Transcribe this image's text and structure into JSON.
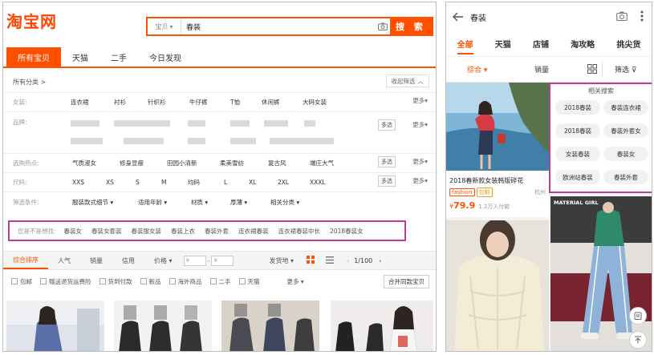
{
  "desktop": {
    "logo": "淘宝网",
    "search": {
      "category": "宝贝",
      "query": "春装",
      "button": "搜 索"
    },
    "tabs": [
      "所有宝贝",
      "天猫",
      "二手",
      "今日发现"
    ],
    "breadcrumb": "所有分类 >",
    "collapse_label": "收起筛选",
    "filters": {
      "style": {
        "label": "女装:",
        "values": [
          "连衣裙",
          "衬衫",
          "针织衫",
          "牛仔裤",
          "T恤",
          "休闲裤",
          "大码女装"
        ]
      },
      "brand": {
        "label": "品牌:"
      },
      "hot": {
        "label": "选购热点:",
        "values": [
          "气质淑女",
          "修身显瘦",
          "田园小清新",
          "柔美雪纺",
          "复古风",
          "端庄大气"
        ]
      },
      "size": {
        "label": "尺码:",
        "values": [
          "XXS",
          "XS",
          "S",
          "M",
          "均码",
          "L",
          "XL",
          "2XL",
          "XXXL"
        ]
      },
      "conditions": {
        "label": "筛选条件:",
        "values": [
          "服装款式细节",
          "适用年龄",
          "材质",
          "厚薄",
          "相关分类"
        ]
      }
    },
    "more_label": "更多",
    "multi_label": "多选",
    "guess": {
      "label": "您是不是想找:",
      "items": [
        "春装女",
        "春装女套装",
        "春装服女装",
        "春装上衣",
        "春装外套",
        "连衣裙春装",
        "连衣裙春装中长",
        "2018春装女"
      ]
    },
    "sort": {
      "items": [
        "综合排序",
        "人气",
        "销量",
        "信用",
        "价格"
      ],
      "price_min": "¥",
      "price_max": "¥",
      "ship_from": "发货地",
      "pager": "1/100"
    },
    "checks": [
      "包邮",
      "赠送退货运费险",
      "货到付款",
      "新品",
      "海外商品",
      "二手",
      "天猫"
    ],
    "checks_more": "更多",
    "merge_label": "合并同款宝贝"
  },
  "mobile": {
    "query": "春装",
    "tabs": [
      "全部",
      "天猫",
      "店铺",
      "淘攻略",
      "挑尖货"
    ],
    "sort": {
      "composite": "综合",
      "sales": "销量",
      "filter": "筛选"
    },
    "product": {
      "title": "2018春新款女装韩版碎花",
      "tag1": "fashion",
      "tag2": "包邮",
      "location": "杭州",
      "price_symbol": "¥",
      "price": "79.9",
      "sold": "1.2万人付款"
    },
    "related": {
      "title": "相关搜索",
      "items": [
        "2018春装",
        "春装连衣裙",
        "2018春装",
        "春装外套女",
        "女装春装",
        "春装女",
        "欧洲站春装",
        "春装外套"
      ]
    },
    "card2_tag": "MATERIAL GIRL"
  },
  "colors": {
    "accent": "#ff5000",
    "highlight": "#c23a9a"
  }
}
